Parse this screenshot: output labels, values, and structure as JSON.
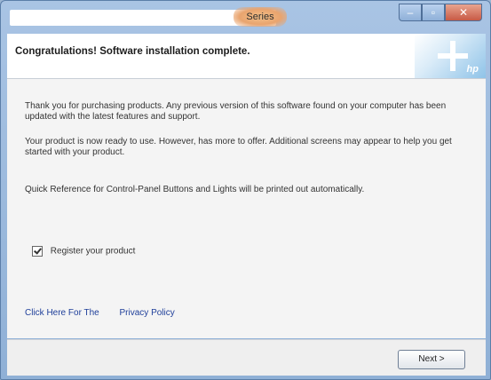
{
  "window": {
    "title": "Series",
    "buttons": {
      "minimize": "–",
      "maximize": "▫",
      "close": "✕"
    }
  },
  "header": {
    "title": "Congratulations! Software installation complete.",
    "logo_text": "hp"
  },
  "content": {
    "paragraph1": "Thank you for purchasing       products. Any previous version of this software found on your computer has been updated with the latest features and support.",
    "paragraph2": "Your product is now ready to use. However,                          has more to offer. Additional screens may appear to help you get started with your product.",
    "paragraph3": "Quick Reference for Control-Panel Buttons and Lights will be printed out automatically.",
    "checkbox_label": "Register your product",
    "checkbox_checked": true,
    "links": [
      "Click Here For The",
      "Privacy Policy"
    ]
  },
  "footer": {
    "next_label": "Next >"
  }
}
